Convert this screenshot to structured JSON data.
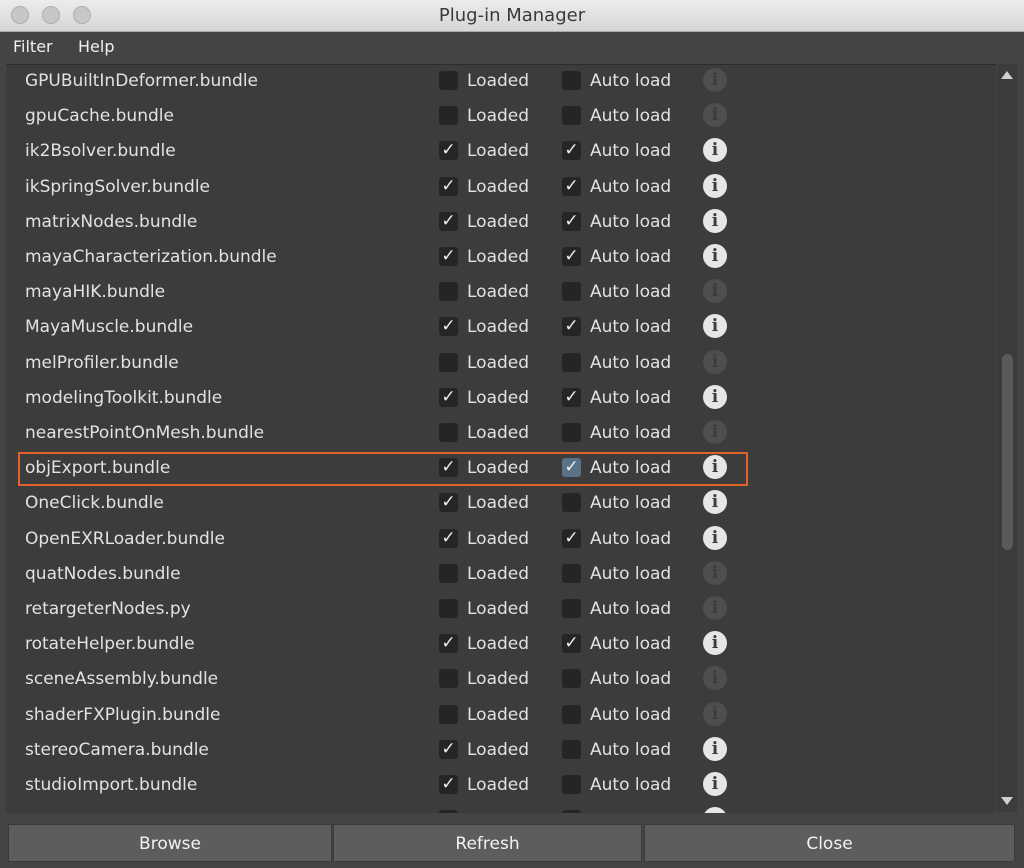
{
  "window": {
    "title": "Plug-in Manager",
    "controls": [
      "close",
      "minimize",
      "zoom"
    ]
  },
  "menu": [
    "Filter",
    "Help"
  ],
  "columns": {
    "loaded_label": "Loaded",
    "autoload_label": "Auto load"
  },
  "plugins": [
    {
      "name": "GPUBuiltInDeformer.bundle",
      "loaded": false,
      "autoload": false,
      "info_enabled": false
    },
    {
      "name": "gpuCache.bundle",
      "loaded": false,
      "autoload": false,
      "info_enabled": false
    },
    {
      "name": "ik2Bsolver.bundle",
      "loaded": true,
      "autoload": true,
      "info_enabled": true
    },
    {
      "name": "ikSpringSolver.bundle",
      "loaded": true,
      "autoload": true,
      "info_enabled": true
    },
    {
      "name": "matrixNodes.bundle",
      "loaded": true,
      "autoload": true,
      "info_enabled": true
    },
    {
      "name": "mayaCharacterization.bundle",
      "loaded": true,
      "autoload": true,
      "info_enabled": true
    },
    {
      "name": "mayaHIK.bundle",
      "loaded": false,
      "autoload": false,
      "info_enabled": false
    },
    {
      "name": "MayaMuscle.bundle",
      "loaded": true,
      "autoload": true,
      "info_enabled": true
    },
    {
      "name": "melProfiler.bundle",
      "loaded": false,
      "autoload": false,
      "info_enabled": false
    },
    {
      "name": "modelingToolkit.bundle",
      "loaded": true,
      "autoload": true,
      "info_enabled": true
    },
    {
      "name": "nearestPointOnMesh.bundle",
      "loaded": false,
      "autoload": false,
      "info_enabled": false
    },
    {
      "name": "objExport.bundle",
      "loaded": true,
      "autoload": true,
      "info_enabled": true,
      "highlighted": true
    },
    {
      "name": "OneClick.bundle",
      "loaded": true,
      "autoload": false,
      "info_enabled": true
    },
    {
      "name": "OpenEXRLoader.bundle",
      "loaded": true,
      "autoload": true,
      "info_enabled": true
    },
    {
      "name": "quatNodes.bundle",
      "loaded": false,
      "autoload": false,
      "info_enabled": false
    },
    {
      "name": "retargeterNodes.py",
      "loaded": false,
      "autoload": false,
      "info_enabled": false
    },
    {
      "name": "rotateHelper.bundle",
      "loaded": true,
      "autoload": true,
      "info_enabled": true
    },
    {
      "name": "sceneAssembly.bundle",
      "loaded": false,
      "autoload": false,
      "info_enabled": false
    },
    {
      "name": "shaderFXPlugin.bundle",
      "loaded": false,
      "autoload": false,
      "info_enabled": false
    },
    {
      "name": "stereoCamera.bundle",
      "loaded": true,
      "autoload": false,
      "info_enabled": true
    },
    {
      "name": "studioImport.bundle",
      "loaded": true,
      "autoload": false,
      "info_enabled": true
    }
  ],
  "buttons": {
    "browse": "Browse",
    "refresh": "Refresh",
    "close": "Close"
  },
  "glyphs": {
    "check": "✓",
    "info": "i"
  },
  "colors": {
    "highlight_border": "#e0622a",
    "panel_bg": "#3c3c3c",
    "window_bg": "#444444"
  }
}
